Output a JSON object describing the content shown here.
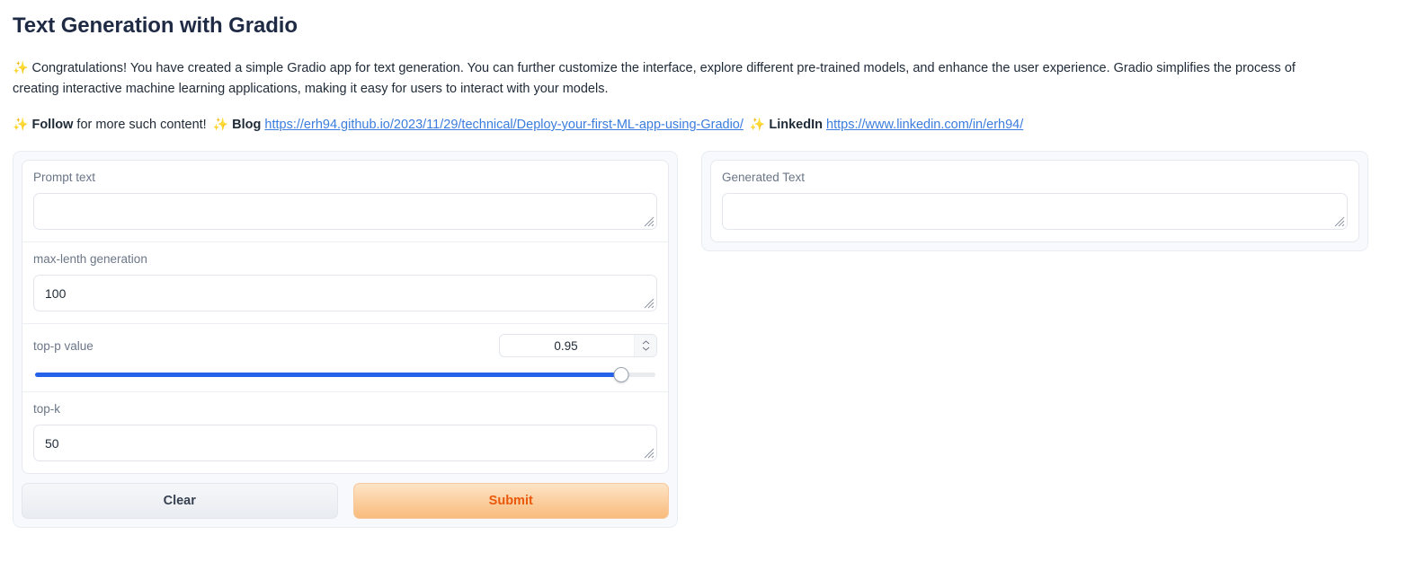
{
  "header": {
    "title": "Text Generation with Gradio",
    "sparkle_icon": "✨",
    "paragraph": "Congratulations! You have created a simple Gradio app for text generation. You can further customize the interface, explore different pre-trained models, and enhance the user experience. Gradio simplifies the process of creating interactive machine learning applications, making it easy for users to interact with your models.",
    "follow_label": "Follow",
    "follow_rest": "for more such content!",
    "blog_label": "Blog",
    "blog_url": "https://erh94.github.io/2023/11/29/technical/Deploy-your-first-ML-app-using-Gradio/",
    "linkedin_label": "LinkedIn",
    "linkedin_url": "https://www.linkedin.com/in/erh94/"
  },
  "inputs": {
    "prompt": {
      "label": "Prompt text",
      "value": "",
      "placeholder": ""
    },
    "max_length": {
      "label": "max-lenth generation",
      "value": "100",
      "placeholder": ""
    },
    "top_p": {
      "label": "top-p value",
      "value": "0.95",
      "min": 0,
      "max": 1,
      "fill_percent": 94.5
    },
    "top_k": {
      "label": "top-k",
      "value": "50",
      "placeholder": ""
    }
  },
  "actions": {
    "clear_label": "Clear",
    "submit_label": "Submit"
  },
  "output": {
    "label": "Generated Text",
    "value": "",
    "placeholder": ""
  },
  "colors": {
    "title": "#1f2a44",
    "link": "#3b7ddd",
    "sparkle": "#f5a64a",
    "slider_fill": "#2563eb",
    "submit_text": "#ea580c",
    "panel_bg": "#f7f9fc"
  }
}
